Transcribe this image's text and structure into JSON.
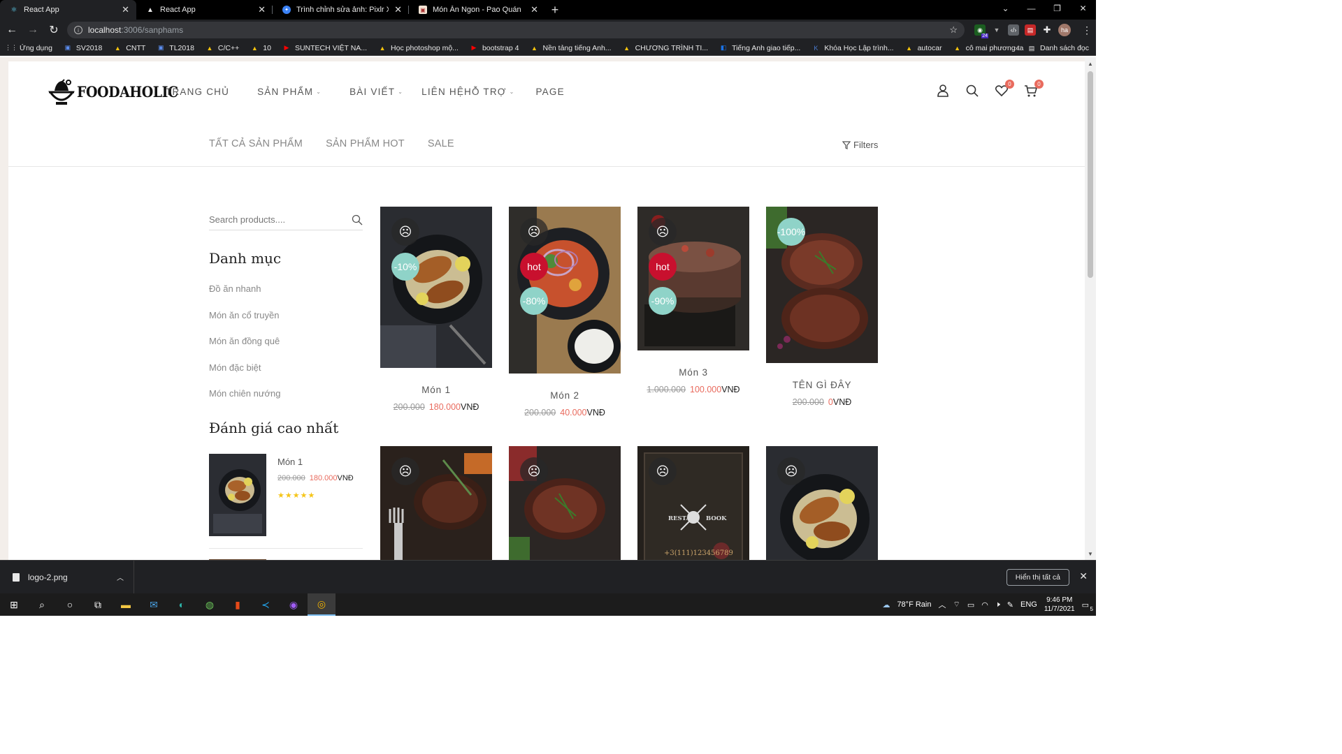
{
  "browser": {
    "tabs": [
      {
        "title": "React App",
        "icon": "react-icon",
        "active": true
      },
      {
        "title": "React App",
        "icon": "vercel-icon",
        "active": false
      },
      {
        "title": "Trình chỉnh sửa ảnh: Pixlr X - chỉn",
        "icon": "pixlr-icon",
        "active": false
      },
      {
        "title": "Món Ăn Ngon - Pao Quán",
        "icon": "restaurant-icon",
        "active": false
      }
    ],
    "url_host": "localhost",
    "url_path": ":3006/sanphams",
    "bookmarks": [
      {
        "label": "Ứng dụng",
        "icon": "apps-grid-icon"
      },
      {
        "label": "SV2018",
        "icon": "bookmark-icon"
      },
      {
        "label": "CNTT",
        "icon": "drive-icon"
      },
      {
        "label": "TL2018",
        "icon": "bookmark-icon"
      },
      {
        "label": "C/C++",
        "icon": "drive-icon"
      },
      {
        "label": "10",
        "icon": "drive-icon"
      },
      {
        "label": "SUNTECH VIỆT NA...",
        "icon": "youtube-icon"
      },
      {
        "label": "Học photoshop mộ...",
        "icon": "drive-icon"
      },
      {
        "label": "bootstrap 4",
        "icon": "youtube-icon"
      },
      {
        "label": "Nền tảng tiếng Anh...",
        "icon": "drive-icon"
      },
      {
        "label": "CHƯƠNG TRÌNH TI...",
        "icon": "drive-icon"
      },
      {
        "label": "Tiếng Anh giao tiếp...",
        "icon": "app-icon"
      },
      {
        "label": "Khóa Học Lập trình...",
        "icon": "kteam-icon"
      },
      {
        "label": "autocar",
        "icon": "drive-icon"
      },
      {
        "label": "cô mai phương ta",
        "icon": "drive-icon"
      }
    ],
    "reading_list": "Danh sách đọc",
    "more_bookmarks": "»",
    "profile_initials": "ha",
    "ext_badge": "24"
  },
  "site": {
    "logo_text": "FOODAHOLIC",
    "nav": [
      {
        "label": "TRANG CHỦ",
        "dropdown": false
      },
      {
        "label": "SẢN PHẨM",
        "dropdown": true
      },
      {
        "label": "BÀI VIẾT",
        "dropdown": true
      },
      {
        "label": "LIÊN HỆHỖ TRỢ",
        "dropdown": true
      },
      {
        "label": "PAGE",
        "dropdown": false
      }
    ],
    "wishlist_count": "0",
    "cart_count": "0",
    "filter_tabs": [
      "TẤT CẢ SẢN PHẨM",
      "SẢN PHẨM HOT",
      "SALE"
    ],
    "filters_label": "Filters",
    "search_placeholder": "Search products....",
    "categories_title": "Danh mục",
    "categories": [
      "Đồ ăn nhanh",
      "Món ăn cổ truyền",
      "Món ăn đồng quê",
      "Món đặc biệt",
      "Món chiên nướng"
    ],
    "top_rated_title": "Đánh giá cao nhất",
    "top_rated": {
      "name": "Món 1",
      "old_price": "200.000",
      "new_price": "180.000",
      "currency": "VNĐ",
      "rating": 5
    },
    "products": [
      {
        "name": "Món 1",
        "old_price": "200.000",
        "new_price": "180.000",
        "currency": "VNĐ",
        "discount": "-10%",
        "hot": false
      },
      {
        "name": "Món 2",
        "old_price": "200.000",
        "new_price": "40.000",
        "currency": "VNĐ",
        "discount": "-80%",
        "hot": true
      },
      {
        "name": "Món 3",
        "old_price": "1.000.000",
        "new_price": "100.000",
        "currency": "VNĐ",
        "discount": "-90%",
        "hot": true
      },
      {
        "name": "TÊN GÌ ĐÂY",
        "old_price": "200.000",
        "new_price": "0",
        "currency": "VNĐ",
        "discount": "-100%",
        "hot": false
      }
    ],
    "hot_label": "hot",
    "restaurant_card": {
      "left": "RESTA",
      "right": "BOOK",
      "phone": "+3(111)123456789"
    }
  },
  "downloads": {
    "file": "logo-2.png",
    "show_all": "Hiển thị tất cả"
  },
  "taskbar": {
    "weather": "78°F  Rain",
    "lang": "ENG",
    "time": "9:46 PM",
    "date": "11/7/2021",
    "notifications": "5"
  },
  "colors": {
    "accent": "#e96b5e",
    "hot": "#c8102e",
    "discount": "#8fd3c8",
    "star": "#f5c518"
  }
}
